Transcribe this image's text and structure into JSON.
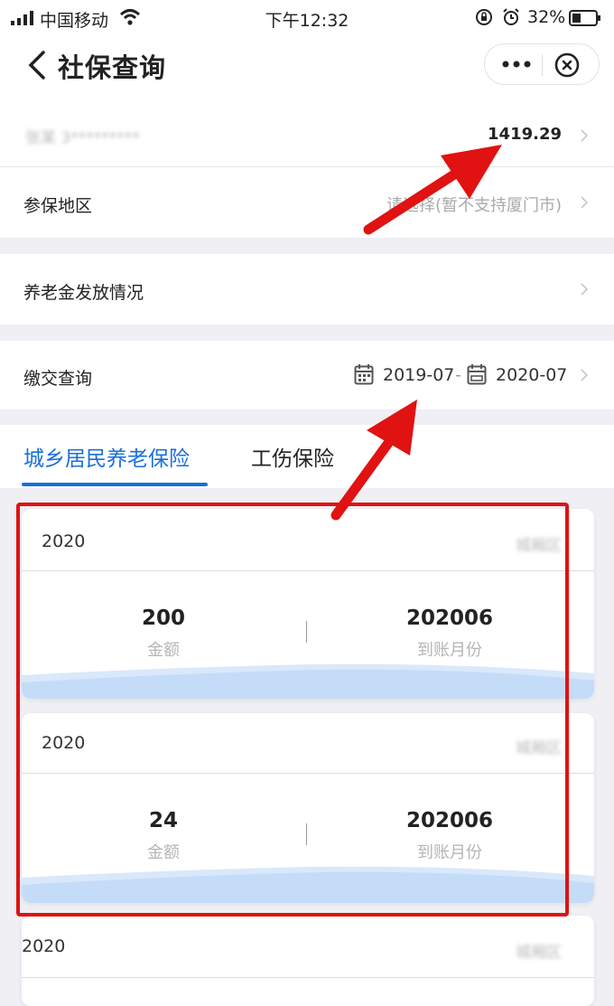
{
  "status_bar": {
    "carrier": "中国移动",
    "time": "下午12:32",
    "battery": "32%"
  },
  "nav": {
    "title": "社保查询",
    "more_icon": "more-dots-icon",
    "close_icon": "close-circle-icon"
  },
  "rows": {
    "account_amount": "1419.29",
    "region_label": "参保地区",
    "region_value": "请选择(暂不支持厦门市)",
    "pension_label": "养老金发放情况",
    "payment_label": "缴交查询",
    "date_from": "2019-07",
    "date_sep": "-",
    "date_to": "2020-07"
  },
  "tabs": [
    {
      "label": "城乡居民养老保险",
      "active": true
    },
    {
      "label": "工伤保险",
      "active": false
    }
  ],
  "records": [
    {
      "year": "2020",
      "amount": "200",
      "amount_caption": "金额",
      "month": "202006",
      "month_caption": "到账月份",
      "region": "城厢区"
    },
    {
      "year": "2020",
      "amount": "24",
      "amount_caption": "金额",
      "month": "202006",
      "month_caption": "到账月份",
      "region": "城厢区"
    },
    {
      "year": "2020",
      "region": "城厢区"
    }
  ],
  "colors": {
    "accent": "#1a6fd9",
    "annotation_red": "#e01212",
    "background": "#efeff4"
  }
}
